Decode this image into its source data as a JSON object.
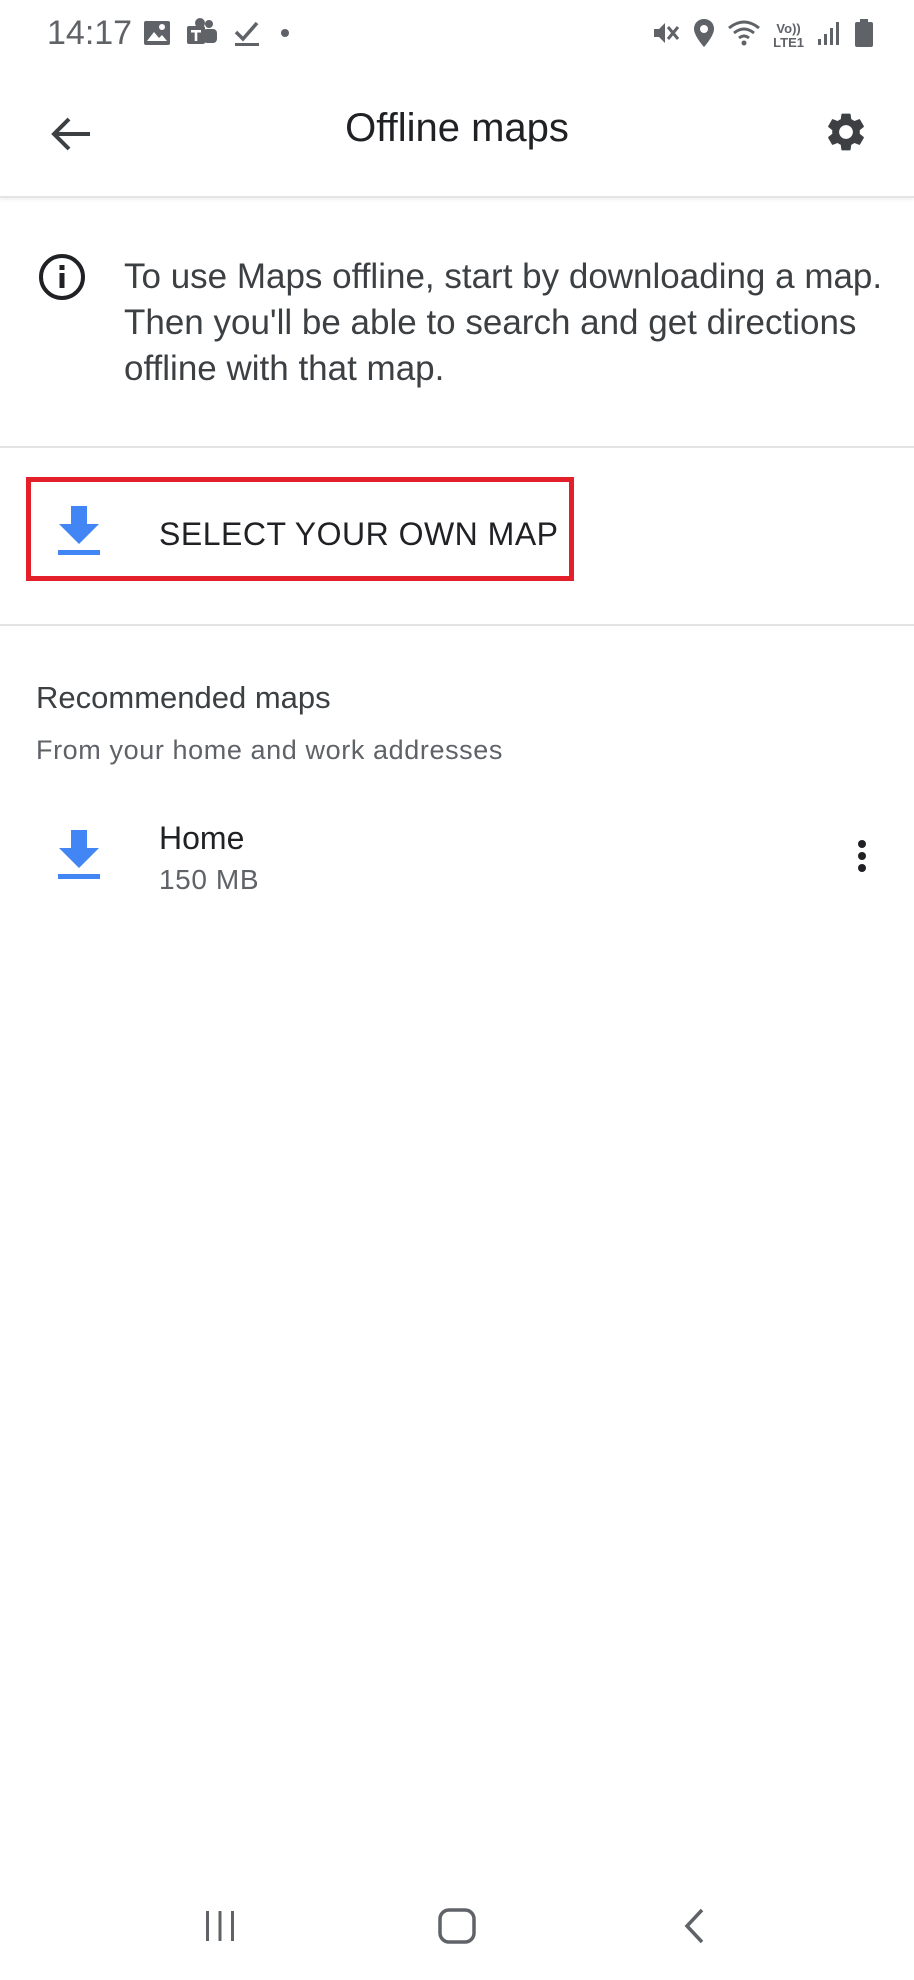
{
  "status_bar": {
    "time": "14:17",
    "left_icons": [
      "gallery-icon",
      "teams-icon",
      "check-icon",
      "dot-icon"
    ],
    "right_icons": [
      "mute-icon",
      "location-icon",
      "wifi-icon",
      "volte-icon",
      "signal-icon",
      "battery-icon"
    ],
    "volte_label_top": "Vo))",
    "volte_label_bottom": "LTE1"
  },
  "app_bar": {
    "title": "Offline maps",
    "back_icon": "arrow-back-icon",
    "settings_icon": "gear-icon"
  },
  "info": {
    "icon": "info-icon",
    "text": "To use Maps offline, start by downloading a map. Then you'll be able to search and get directions offline with that map."
  },
  "select_map": {
    "icon": "download-icon",
    "label": "SELECT YOUR OWN MAP",
    "highlight_color": "#e3202a"
  },
  "recommended": {
    "heading": "Recommended maps",
    "subheading": "From your home and work addresses",
    "items": [
      {
        "name": "Home",
        "size": "150 MB",
        "icon": "download-icon",
        "menu_icon": "more-vert-icon"
      }
    ]
  },
  "nav_bar": {
    "buttons": [
      "recent-apps-icon",
      "home-icon",
      "back-icon"
    ]
  },
  "colors": {
    "accent_blue": "#4285f4",
    "text_primary": "#202124",
    "text_secondary": "#5f6368",
    "divider": "#e4e4e4"
  }
}
